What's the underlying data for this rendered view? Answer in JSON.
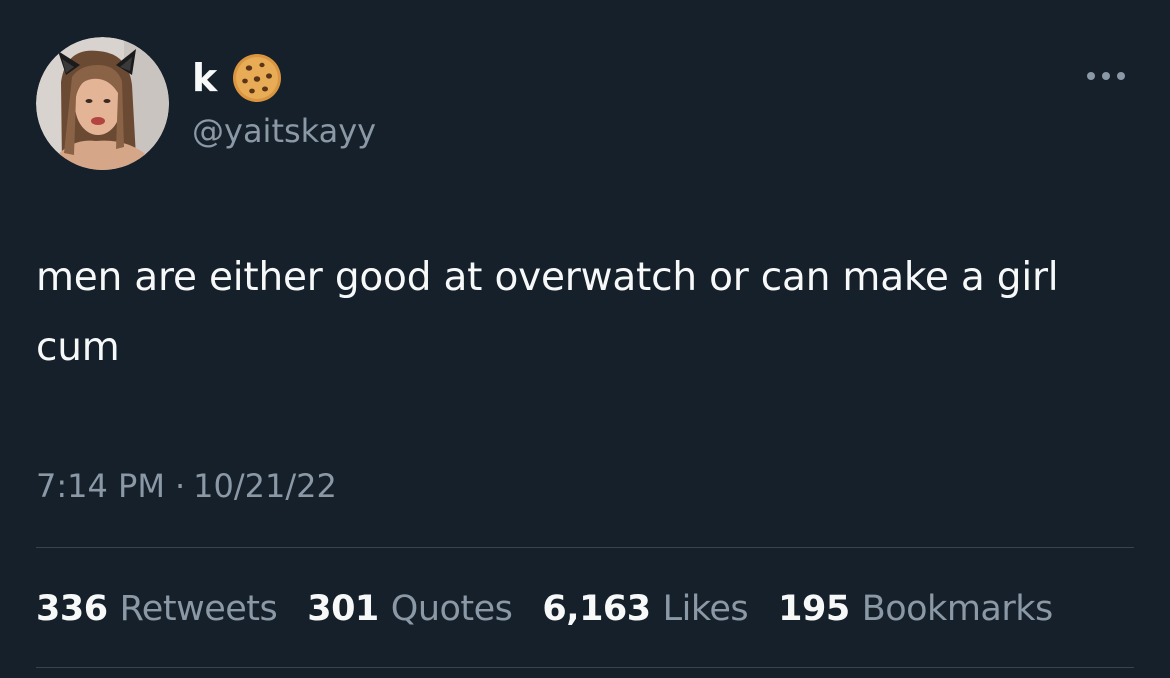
{
  "author": {
    "display_name": "k",
    "emoji": "cookie-emoji",
    "handle": "@yaitskayy",
    "avatar": "profile-photo"
  },
  "tweet": {
    "text": "men are either good at overwatch or can make a girl cum",
    "time": "7:14 PM",
    "separator": "·",
    "date": "10/21/22"
  },
  "stats": [
    {
      "count": "336",
      "label": "Retweets"
    },
    {
      "count": "301",
      "label": "Quotes"
    },
    {
      "count": "6,163",
      "label": "Likes"
    },
    {
      "count": "195",
      "label": "Bookmarks"
    }
  ],
  "icons": {
    "more": "more-horizontal-icon"
  },
  "colors": {
    "background": "#15202b",
    "primary_text": "#f7f9f9",
    "secondary_text": "#8b98a5",
    "divider": "#38444d"
  }
}
